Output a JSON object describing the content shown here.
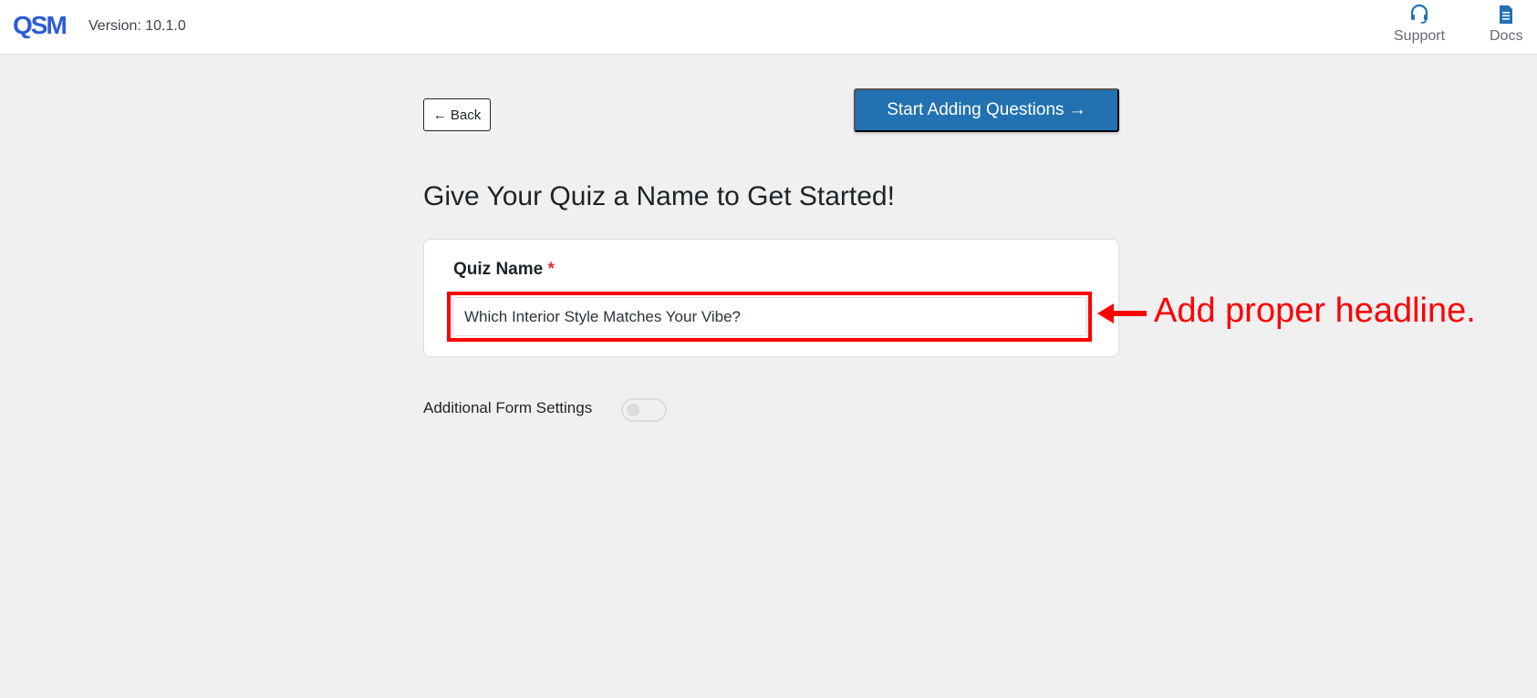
{
  "header": {
    "logo_text": "QSM",
    "version": "Version: 10.1.0",
    "links": [
      {
        "label": "Support",
        "icon": "headset-icon"
      },
      {
        "label": "Docs",
        "icon": "document-icon"
      }
    ]
  },
  "actions": {
    "back_label": "← Back",
    "start_label": "Start Adding Questions →"
  },
  "form": {
    "title": "Give Your Quiz a Name to Get Started!",
    "quiz_name_label": "Quiz Name",
    "required_marker": "*",
    "quiz_name_value": "Which Interior Style Matches Your Vibe?"
  },
  "annotation": {
    "text": "Add proper headline.",
    "color": "#ff0000"
  },
  "settings": {
    "additional_label": "Additional Form Settings",
    "additional_enabled": false
  },
  "colors": {
    "primary": "#2271b1",
    "logo": "#2b5bd7",
    "required": "#d63638"
  }
}
